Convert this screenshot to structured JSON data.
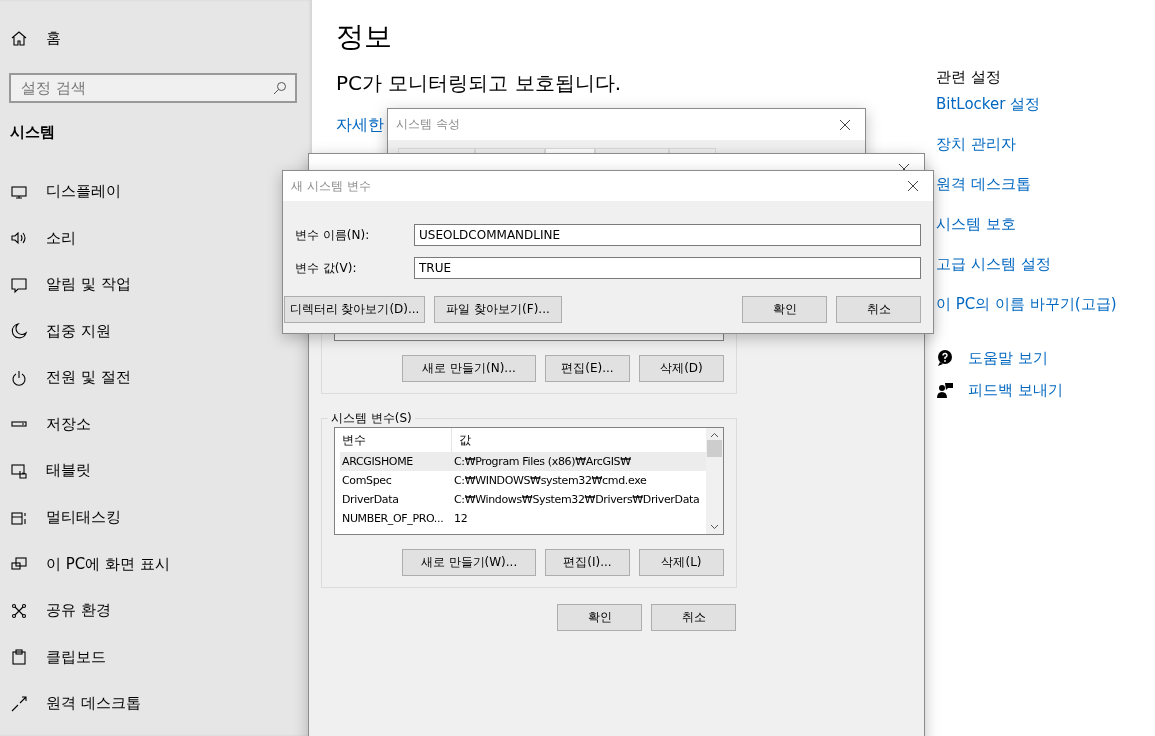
{
  "sidebar": {
    "home": "홈",
    "search": {
      "placeholder": "설정 검색"
    },
    "section": "시스템",
    "items": [
      {
        "label": "디스플레이"
      },
      {
        "label": "소리"
      },
      {
        "label": "알림 및 작업"
      },
      {
        "label": "집중 지원"
      },
      {
        "label": "전원 및 절전"
      },
      {
        "label": "저장소"
      },
      {
        "label": "태블릿"
      },
      {
        "label": "멀티태스킹"
      },
      {
        "label": "이 PC에 화면 표시"
      },
      {
        "label": "공유 환경"
      },
      {
        "label": "클립보드"
      },
      {
        "label": "원격 데스크톱"
      }
    ]
  },
  "main": {
    "title": "정보",
    "status": "PC가 모니터링되고 보호됩니다.",
    "link": "자세한"
  },
  "related": {
    "heading": "관련 설정",
    "links": [
      "BitLocker 설정",
      "장치 관리자",
      "원격 데스크톱",
      "시스템 보호",
      "고급 시스템 설정",
      "이 PC의 이름 바꾸기(고급)"
    ]
  },
  "help": [
    {
      "label": "도움말 보기"
    },
    {
      "label": "피드백 보내기"
    }
  ],
  "system_properties": {
    "title": "시스템 속성"
  },
  "environment_variables": {
    "user_buttons": [
      "새로 만들기(N)...",
      "편집(E)...",
      "삭제(D)"
    ],
    "system_group": {
      "legend": "시스템 변수(S)",
      "columns": [
        "변수",
        "값"
      ],
      "rows": [
        {
          "name": "ARCGISHOME",
          "value": "C:₩Program Files (x86)₩ArcGIS₩",
          "selected": true
        },
        {
          "name": "ComSpec",
          "value": "C:₩WINDOWS₩system32₩cmd.exe",
          "selected": false
        },
        {
          "name": "DriverData",
          "value": "C:₩Windows₩System32₩Drivers₩DriverData",
          "selected": false
        },
        {
          "name": "NUMBER_OF_PRO...",
          "value": "12",
          "selected": false
        }
      ],
      "buttons": [
        "새로 만들기(W)...",
        "편집(I)...",
        "삭제(L)"
      ]
    },
    "buttons": [
      "확인",
      "취소"
    ]
  },
  "new_variable": {
    "title": "새 시스템 변수",
    "fields": [
      {
        "label": "변수 이름(N):",
        "value": "USEOLDCOMMANDLINE"
      },
      {
        "label": "변수 값(V):",
        "value": "TRUE"
      }
    ],
    "browse_buttons": [
      "디렉터리 찾아보기(D)...",
      "파일 찾아보기(F)..."
    ],
    "buttons": [
      "확인",
      "취소"
    ]
  }
}
